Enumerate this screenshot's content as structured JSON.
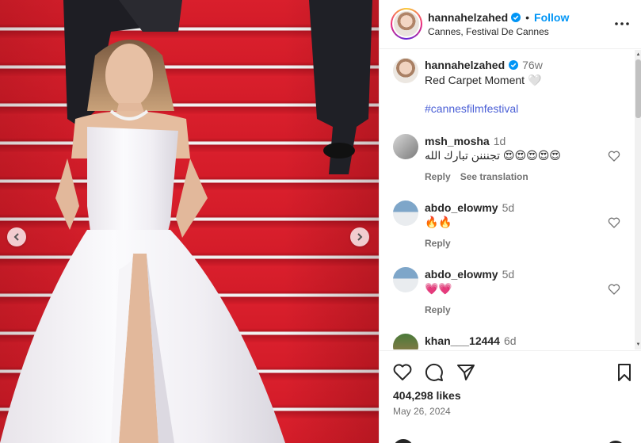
{
  "header": {
    "username": "hannahelzahed",
    "separator": "•",
    "follow_label": "Follow",
    "location": "Cannes, Festival De Cannes",
    "more_icon": "more-horizontal-icon"
  },
  "caption": {
    "username": "hannahelzahed",
    "time": "76w",
    "text": "Red Carpet Moment 🤍",
    "hashtag": "#cannesfilmfestival"
  },
  "comments": [
    {
      "username": "msh_mosha",
      "time": "1d",
      "text": "تجنننن تبارك الله 😍😍😍😍😍",
      "reply": "Reply",
      "translate": "See translation"
    },
    {
      "username": "abdo_elowmy",
      "time": "5d",
      "text": "🔥🔥",
      "reply": "Reply"
    },
    {
      "username": "abdo_elowmy",
      "time": "5d",
      "text": "💗💗",
      "reply": "Reply"
    },
    {
      "username": "khan___12444",
      "time": "6d",
      "text": ""
    }
  ],
  "stats": {
    "likes": "404,298 likes",
    "date": "May 26, 2024"
  },
  "colors": {
    "accent": "#0095f6",
    "hashtag": "#4a5fd6",
    "carpet": "#d41c29"
  }
}
